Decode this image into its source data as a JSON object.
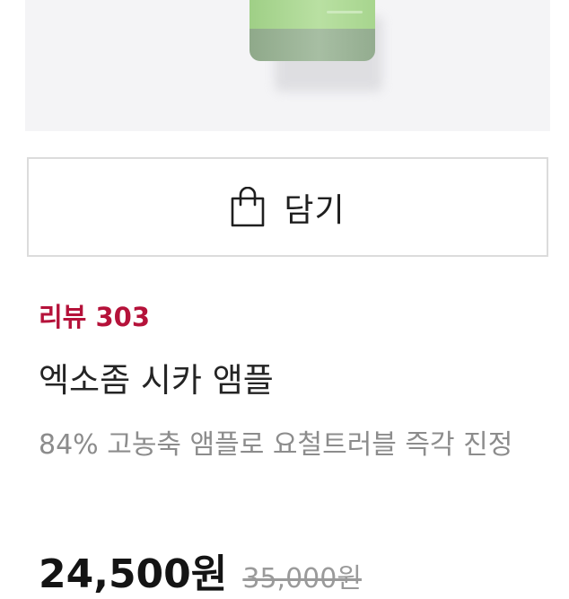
{
  "product": {
    "image_icon": "product-bottle-image",
    "cart_button": {
      "label": "담기",
      "icon": "shopping-bag-icon"
    },
    "review": {
      "label": "리뷰 303"
    },
    "name": "엑소좀 시카 앰플",
    "description": "84% 고농축 앰플로 요철트러블 즉각 진정",
    "price": {
      "sale": "24,500원",
      "original": "35,000원"
    }
  },
  "colors": {
    "review_accent": "#b5123a",
    "bottle_green": "#b9e0a2",
    "bottle_base": "#a7bea3"
  }
}
